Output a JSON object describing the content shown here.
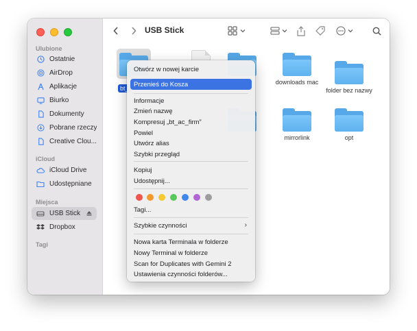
{
  "window": {
    "title": "USB Stick"
  },
  "sidebar": {
    "sections": [
      {
        "title": "Ulubione",
        "items": [
          "Ostatnie",
          "AirDrop",
          "Aplikacje",
          "Biurko",
          "Dokumenty",
          "Pobrane rzeczy",
          "Creative Clou..."
        ]
      },
      {
        "title": "iCloud",
        "items": [
          "iCloud Drive",
          "Udostępniane"
        ]
      },
      {
        "title": "Miejsca",
        "items": [
          "USB Stick",
          "Dropbox"
        ]
      },
      {
        "title": "Tagi",
        "items": []
      }
    ],
    "selected": "USB Stick"
  },
  "files": [
    {
      "name": "bt_",
      "type": "folder",
      "selected": true
    },
    {
      "name": "",
      "type": "document"
    },
    {
      "name": "",
      "type": "folder"
    },
    {
      "name": "downloads mac",
      "type": "folder"
    },
    {
      "name": "folder bez nazwy",
      "type": "folder"
    },
    {
      "name": "",
      "type": "folder"
    },
    {
      "name": "mirrorlink",
      "type": "folder"
    },
    {
      "name": "opt",
      "type": "folder"
    }
  ],
  "context_menu": {
    "items": [
      "Otwórz w nowej karcie",
      "Przenieś do Kosza",
      "Informacje",
      "Zmień nazwę",
      "Kompresuj „bt_ac_firm”",
      "Powiel",
      "Utwórz alias",
      "Szybki przegląd",
      "Kopiuj",
      "Udostępnij...",
      "Tagi...",
      "Szybkie czynności",
      "Nowa karta Terminala w folderze",
      "Nowy Terminal w folderze",
      "Scan for Duplicates with Gemini 2",
      "Ustawienia czynności folderów..."
    ],
    "highlighted": "Przenieś do Kosza",
    "tag_colors": [
      "#f0554d",
      "#f29a2e",
      "#f4c931",
      "#5ac75d",
      "#3f86ef",
      "#b067d5",
      "#9d9d9f"
    ]
  }
}
